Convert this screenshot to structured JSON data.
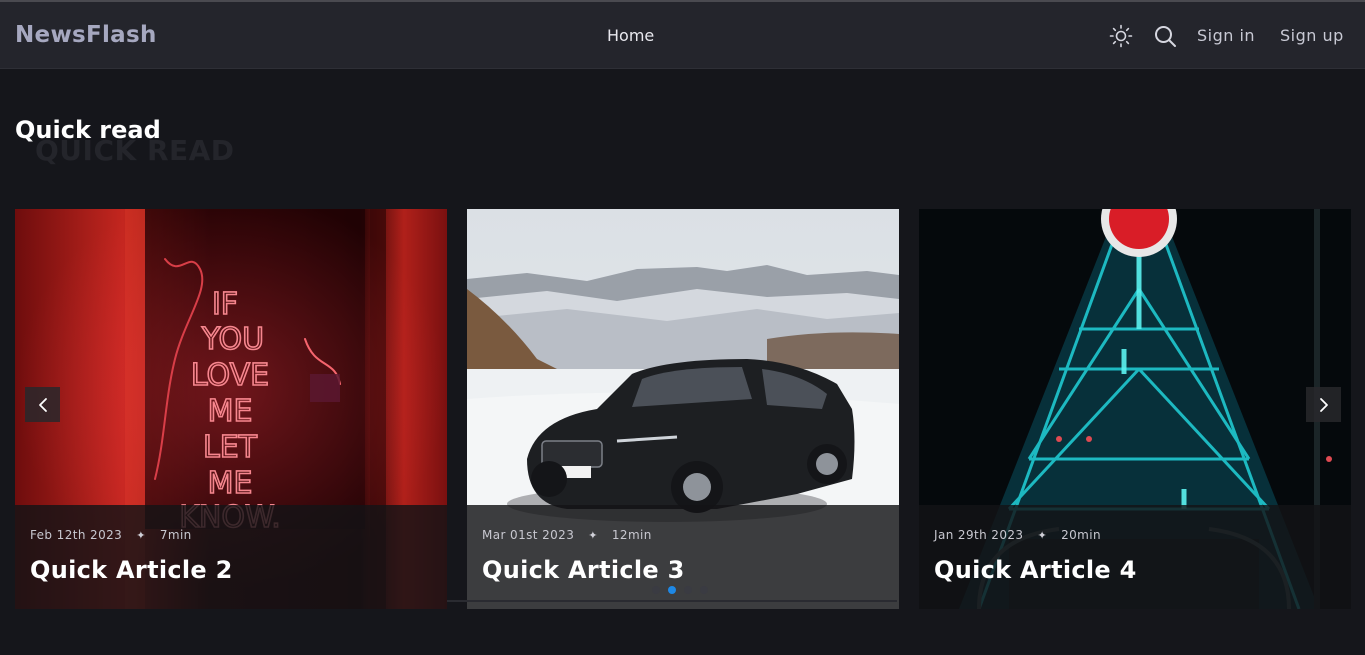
{
  "nav": {
    "brand": "NewsFlash",
    "home": "Home",
    "sign_in": "Sign in",
    "sign_up": "Sign up",
    "theme_icon": "sun-icon",
    "search_icon": "search-icon"
  },
  "section": {
    "title": "Quick read",
    "ghost_title": "QUICK READ"
  },
  "cards": [
    {
      "date": "Feb 12th 2023",
      "read_time": "7min",
      "title": "Quick Article 2",
      "image": "red neon sign reading IF YOU LOVE ME LET ME KNOW"
    },
    {
      "date": "Mar 01st 2023",
      "read_time": "12min",
      "title": "Quick Article 3",
      "image": "black SUV on snowy hills"
    },
    {
      "date": "Jan 29th 2023",
      "read_time": "20min",
      "title": "Quick Article 4",
      "image": "teal-lit steel structure at night"
    }
  ],
  "carousel": {
    "slide_count": 4,
    "active_index": 1
  },
  "colors": {
    "background": "#15161b",
    "navbar": "#24252c",
    "brand": "#a6a8c0",
    "accent": "#1e88e5"
  }
}
